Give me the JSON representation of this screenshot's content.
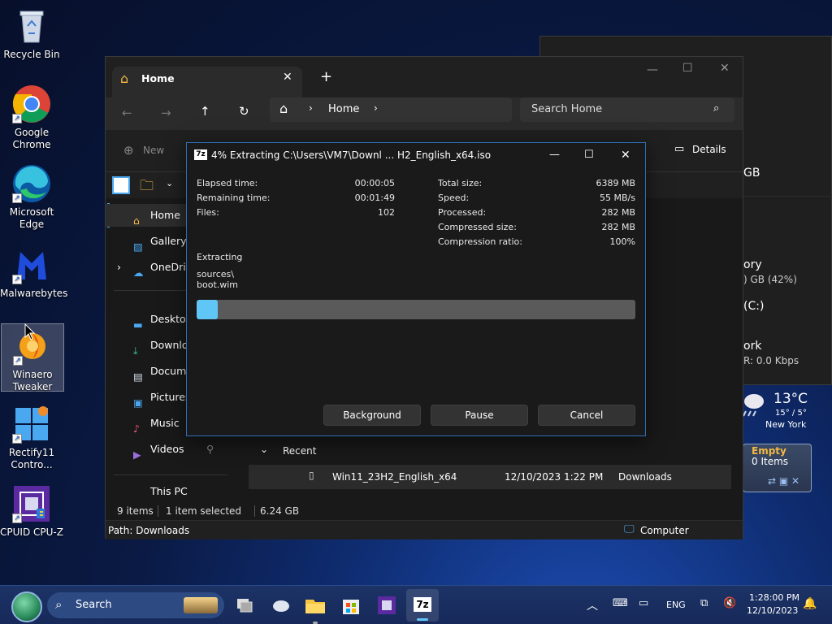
{
  "desktop": {
    "icons": [
      {
        "label": "Recycle Bin"
      },
      {
        "label": "Google Chrome"
      },
      {
        "label": "Microsoft Edge"
      },
      {
        "label": "Malwarebytes"
      },
      {
        "label": "Winaero Tweaker"
      },
      {
        "label": "Rectify11 Contro..."
      },
      {
        "label": "CPUID CPU-Z"
      }
    ]
  },
  "background_widgets": {
    "drive_text": "GB",
    "memory_label": "ory",
    "memory_value": ") GB (42%)",
    "drive_c": "(C:)",
    "network_label": "ork",
    "network_value": "R: 0.0 Kbps",
    "weather_temp": "13°C",
    "weather_range": "15° / 5°",
    "weather_city": "New York",
    "recycle_status": "Empty",
    "recycle_items": "0 Items"
  },
  "explorer": {
    "tab_title": "Home",
    "address": "Home",
    "search_placeholder": "Search Home",
    "new_label": "New",
    "details_label": "Details",
    "nav": [
      {
        "label": "Home",
        "icon": "home-icon"
      },
      {
        "label": "Gallery",
        "icon": "gallery-icon"
      },
      {
        "label": "OneDriv",
        "icon": "onedrive-icon"
      },
      {
        "label": "Desktop",
        "icon": "desktop-icon"
      },
      {
        "label": "Downloa",
        "icon": "download-icon"
      },
      {
        "label": "Docume",
        "icon": "document-icon"
      },
      {
        "label": "Pictures",
        "icon": "pictures-icon"
      },
      {
        "label": "Music",
        "icon": "music-icon"
      },
      {
        "label": "Videos",
        "icon": "videos-icon"
      },
      {
        "label": "This PC",
        "icon": "pc-icon"
      }
    ],
    "recent_header": "Recent",
    "recent_row": {
      "name": "Win11_23H2_English_x64",
      "date": "12/10/2023 1:22 PM",
      "location": "Downloads"
    },
    "status_items": "9 items",
    "status_selected": "1 item selected",
    "status_size": "6.24 GB",
    "path": "Path: Downloads",
    "computer": "Computer"
  },
  "zip": {
    "title": "4% Extracting C:\\Users\\VM7\\Downl ... H2_English_x64.iso",
    "left_stats": [
      {
        "label": "Elapsed time:",
        "value": "00:00:05"
      },
      {
        "label": "Remaining time:",
        "value": "00:01:49"
      },
      {
        "label": "Files:",
        "value": "102"
      }
    ],
    "right_stats": [
      {
        "label": "Total size:",
        "value": "6389 MB"
      },
      {
        "label": "Speed:",
        "value": "55 MB/s"
      },
      {
        "label": "Processed:",
        "value": "282 MB"
      },
      {
        "label": "Compressed size:",
        "value": "282 MB"
      },
      {
        "label": "Compression ratio:",
        "value": "100%"
      }
    ],
    "action": "Extracting",
    "path_line1": "sources\\",
    "path_line2": "boot.wim",
    "progress": 0.04,
    "buttons": {
      "background": "Background",
      "pause": "Pause",
      "cancel": "Cancel"
    }
  },
  "taskbar": {
    "search": "Search",
    "lang": "ENG",
    "time": "1:28:00 PM",
    "date": "12/10/2023"
  }
}
